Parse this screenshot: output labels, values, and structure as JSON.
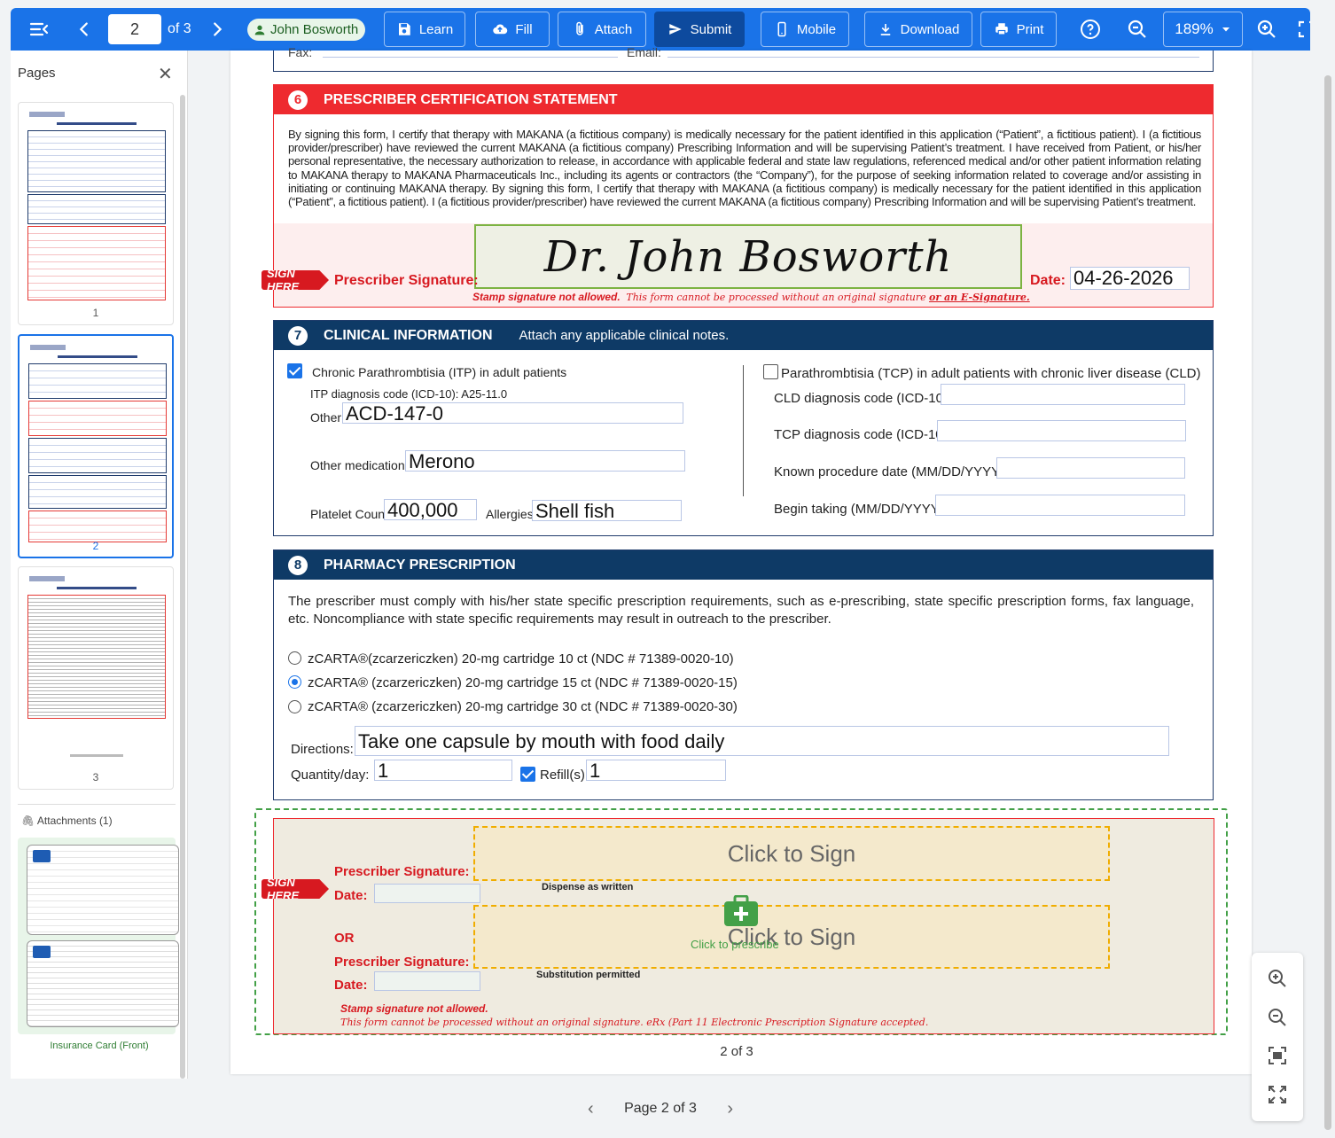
{
  "toolbar": {
    "current_page": "2",
    "of_pages": "of 3",
    "user": "John Bosworth",
    "learn": "Learn",
    "fill": "Fill",
    "attach": "Attach",
    "submit": "Submit",
    "mobile": "Mobile",
    "download": "Download",
    "print": "Print",
    "zoom": "189%"
  },
  "sidebar": {
    "title": "Pages",
    "thumbs": [
      "1",
      "2",
      "3"
    ],
    "attachments_title": "Attachments (1)",
    "attachment_caption": "Insurance Card (Front)"
  },
  "section6": {
    "number": "6",
    "title": "PRESCRIBER CERTIFICATION STATEMENT",
    "top_labels": {
      "fax": "Fax:",
      "email": "Email:"
    },
    "body": "By signing this form, I certify that therapy with MAKANA (a fictitious company) is medically necessary for the patient identified in this application (“Patient”, a fictitious patient). I (a fictitious provider/prescriber) have reviewed the current MAKANA (a fictitious company) Prescribing Information and will be supervising Patient’s treatment. I have received from Patient, or his/her personal representative, the necessary authorization to release, in accordance with applicable federal and state law regulations, referenced medical and/or other patient information relating to MAKANA therapy to MAKANA Pharmaceuticals Inc., including its agents or contractors (the “Company”), for the purpose of seeking information related to coverage and/or assisting in initiating or continuing MAKANA therapy. By signing this form, I certify that therapy with MAKANA (a fictitious company) is medically necessary for the patient identified in this application (“Patient”, a fictitious patient). I (a fictitious provider/prescriber) have reviewed the current MAKANA (a fictitious company) Prescribing Information and will be supervising Patient’s treatment.",
    "sign_here": "SIGN HERE",
    "signature_label": "Prescriber Signature:",
    "signature_value": "Dr. John Bosworth",
    "date_label": "Date:",
    "date_value": "04-26-2026",
    "stamp_note": "Stamp signature not allowed.",
    "stamp_note_2": "This form cannot be processed without an original signature",
    "stamp_note_3": "or an E-Signature."
  },
  "section7": {
    "number": "7",
    "title": "CLINICAL INFORMATION",
    "subtitle": "Attach any applicable clinical notes.",
    "itp_label": "Chronic Parathrombtisia (ITP) in adult patients",
    "itp_checked": true,
    "itp_code": "ITP diagnosis code (ICD-10): A25-11.0",
    "other_label": "Other:",
    "other_value": "ACD-147-0",
    "other_meds_label": "Other medications:",
    "other_meds_value": "Merono",
    "platelet_label": "Platelet Count:",
    "platelet_value": "400,000",
    "allergies_label": "Allergies:",
    "allergies_value": "Shell fish",
    "tcp_label": "Parathrombtisia (TCP) in adult patients with chronic liver disease (CLD)",
    "cld_code_label": "CLD diagnosis code (ICD-10):",
    "tcp_code_label": "TCP diagnosis code (ICD-10):",
    "procedure_label": "Known procedure date (MM/DD/YYYY):",
    "begin_label": "Begin taking (MM/DD/YYYY):"
  },
  "section8": {
    "number": "8",
    "title": "PHARMACY PRESCRIPTION",
    "body": "The prescriber must comply with his/her state specific prescription requirements, such as e-prescribing, state specific prescription forms, fax language, etc. Noncompliance with state specific requirements may result in outreach to the prescriber.",
    "options": [
      "zCARTA®(zcarzericzken) 20-mg cartridge 10 ct (NDC # 71389-0020-10)",
      "zCARTA® (zcarzericzken) 20-mg cartridge 15 ct (NDC # 71389-0020-15)",
      "zCARTA® (zcarzericzken) 20-mg cartridge 30 ct (NDC # 71389-0020-30)"
    ],
    "selected_option": 1,
    "directions_label": "Directions:",
    "directions_value": "Take one capsule by mouth with food daily",
    "quantity_label": "Quantity/day:",
    "quantity_value": "1",
    "refills_label": "Refill(s):",
    "refills_value": "1"
  },
  "sign_block": {
    "sign_here": "SIGN HERE",
    "sig_label_1": "Prescriber Signature:",
    "date_label_1": "Date:",
    "click_to_sign_1": "Click to Sign",
    "dispense_note": "Dispense as written",
    "or_label": "OR",
    "sig_label_2": "Prescriber Signature:",
    "date_label_2": "Date:",
    "click_to_sign_2": "Click to Sign",
    "click_to_prescribe": "Click to prescribe",
    "substitution_note": "Substitution permitted",
    "stamp_note": "Stamp signature not allowed.",
    "erx_note": "This form cannot be processed without an original signature. eRx (Part 11 Electronic Prescription Signature accepted."
  },
  "page_footer": "2 of 3",
  "bottom_nav": "Page 2 of 3",
  "colors": {
    "toolbar": "#1a73e8",
    "red_header": "#ee2a2f",
    "navy_header": "#0e3a66",
    "accent_green": "#2e7d32"
  }
}
